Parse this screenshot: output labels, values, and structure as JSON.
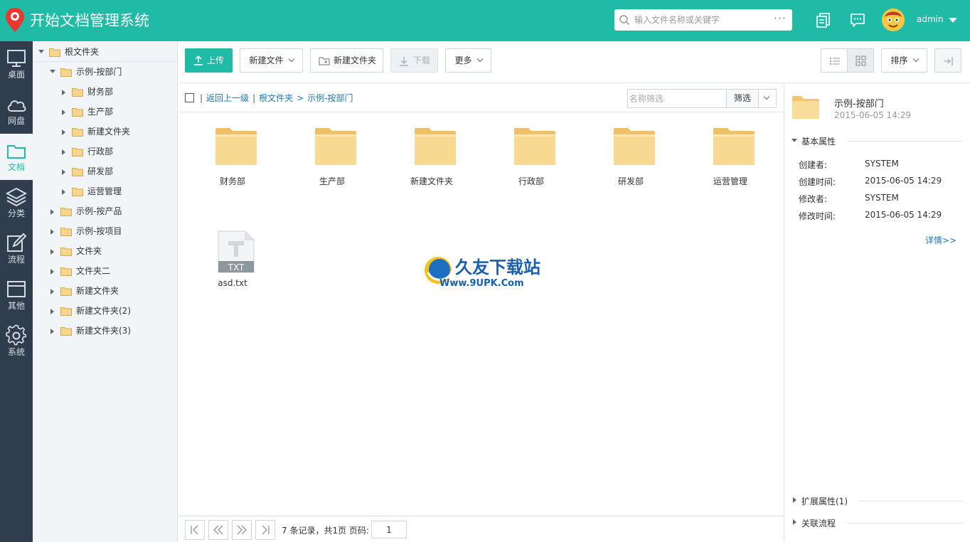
{
  "header": {
    "app_title": "开始文档管理系统",
    "search_placeholder": "输入文件名称或关键字",
    "search_more": "···",
    "user_name": "admin"
  },
  "nav": [
    {
      "label": "桌面",
      "icon": "desktop-icon"
    },
    {
      "label": "网盘",
      "icon": "cloud-icon"
    },
    {
      "label": "文档",
      "icon": "folder-icon",
      "active": true
    },
    {
      "label": "分类",
      "icon": "layers-icon"
    },
    {
      "label": "流程",
      "icon": "edit-icon"
    },
    {
      "label": "其他",
      "icon": "window-icon"
    },
    {
      "label": "系统",
      "icon": "gear-icon"
    }
  ],
  "tree": {
    "root": "根文件夹",
    "items": [
      {
        "label": "示例-按部门",
        "level": 1,
        "expanded": true
      },
      {
        "label": "财务部",
        "level": 2
      },
      {
        "label": "生产部",
        "level": 2
      },
      {
        "label": "新建文件夹",
        "level": 2
      },
      {
        "label": "行政部",
        "level": 2
      },
      {
        "label": "研发部",
        "level": 2
      },
      {
        "label": "运营管理",
        "level": 2
      },
      {
        "label": "示例-按产品",
        "level": 1
      },
      {
        "label": "示例-按项目",
        "level": 1
      },
      {
        "label": "文件夹",
        "level": 1
      },
      {
        "label": "文件夹二",
        "level": 1
      },
      {
        "label": "新建文件夹",
        "level": 1
      },
      {
        "label": "新建文件夹(2)",
        "level": 1
      },
      {
        "label": "新建文件夹(3)",
        "level": 1
      }
    ]
  },
  "toolbar": {
    "upload": "上传",
    "new_file": "新建文件",
    "new_folder": "新建文件夹",
    "download": "下载",
    "more": "更多",
    "sort": "排序"
  },
  "breadcrumb": {
    "back": "返回上一级",
    "root": "根文件夹",
    "current": "示例-按部门",
    "filter_placeholder": "名称筛选",
    "filter_button": "筛选"
  },
  "files": [
    {
      "name": "财务部",
      "type": "folder"
    },
    {
      "name": "生产部",
      "type": "folder"
    },
    {
      "name": "新建文件夹",
      "type": "folder"
    },
    {
      "name": "行政部",
      "type": "folder"
    },
    {
      "name": "研发部",
      "type": "folder"
    },
    {
      "name": "运营管理",
      "type": "folder"
    },
    {
      "name": "asd.txt",
      "type": "txt",
      "badge": "TXT"
    }
  ],
  "watermark": {
    "title": "久友下载站",
    "url": "Www.9UPK.Com"
  },
  "pager": {
    "info": "7 条记录，共1页  页码:",
    "page": "1"
  },
  "details": {
    "name": "示例-按部门",
    "time": "2015-06-05 14:29",
    "basic_title": "基本属性",
    "props": [
      {
        "key": "创建者:",
        "value": "SYSTEM"
      },
      {
        "key": "创建时间:",
        "value": "2015-06-05 14:29"
      },
      {
        "key": "修改者:",
        "value": "SYSTEM"
      },
      {
        "key": "修改时间:",
        "value": "2015-06-05 14:29"
      }
    ],
    "more_link": "详情>>",
    "ext_title": "扩展属性(1)",
    "flow_title": "关联流程"
  },
  "colors": {
    "accent": "#1fbba6",
    "nav_bg": "#2f3d4c",
    "link": "#1d78b8",
    "folder": "#f6d68e"
  }
}
